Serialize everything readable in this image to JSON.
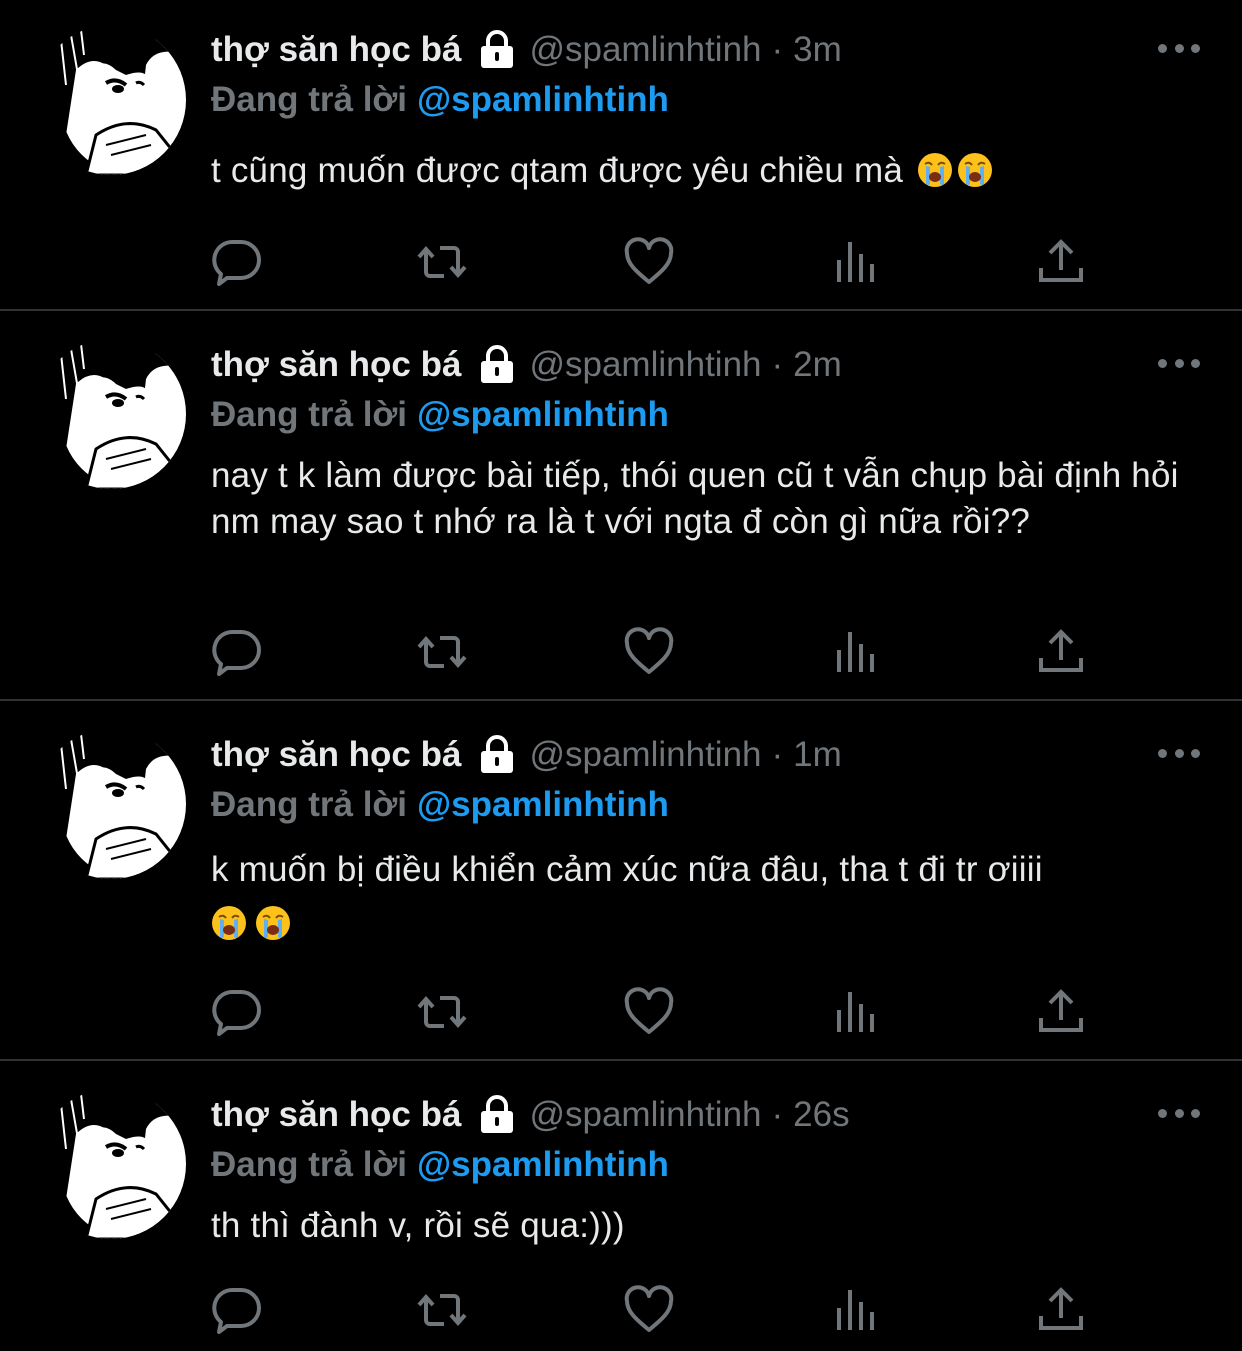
{
  "tweets": [
    {
      "name": "thợ săn học bá",
      "handle": "@spamlinhtinh",
      "time": "3m",
      "reply_label": "Đang trả lời",
      "reply_handle": "@spamlinhtinh",
      "text": "t cũng muốn được qtam được yêu chiều mà",
      "emoji_count": 2
    },
    {
      "name": "thợ săn học bá",
      "handle": "@spamlinhtinh",
      "time": "2m",
      "reply_label": "Đang trả lời",
      "reply_handle": "@spamlinhtinh",
      "text": "nay t k làm được bài tiếp, thói quen cũ t vẫn chụp bài định hỏi nm may sao t nhớ ra là t với ngta đ còn gì nữa rồi??",
      "emoji_count": 0
    },
    {
      "name": "thợ săn học bá",
      "handle": "@spamlinhtinh",
      "time": "1m",
      "reply_label": "Đang trả lời",
      "reply_handle": "@spamlinhtinh",
      "text": "k muốn bị điều khiển cảm xúc nữa đâu, tha t đi tr ơiiii",
      "emoji_count": 2
    },
    {
      "name": "thợ săn học bá",
      "handle": "@spamlinhtinh",
      "time": "26s",
      "reply_label": "Đang trả lời",
      "reply_handle": "@spamlinhtinh",
      "text": "th thì đành v, rồi sẽ qua:)))",
      "emoji_count": 0
    }
  ],
  "separator": "·",
  "icons": {
    "lock": "lock-icon",
    "more": "more-icon",
    "reply": "reply-icon",
    "retweet": "retweet-icon",
    "like": "like-icon",
    "views": "views-icon",
    "share": "share-icon",
    "emoji": "loudly-crying-face-emoji"
  },
  "colors": {
    "background": "#000000",
    "text": "#e7e9ea",
    "muted": "#71767b",
    "link": "#1d9bf0",
    "divider": "#2f3336"
  }
}
